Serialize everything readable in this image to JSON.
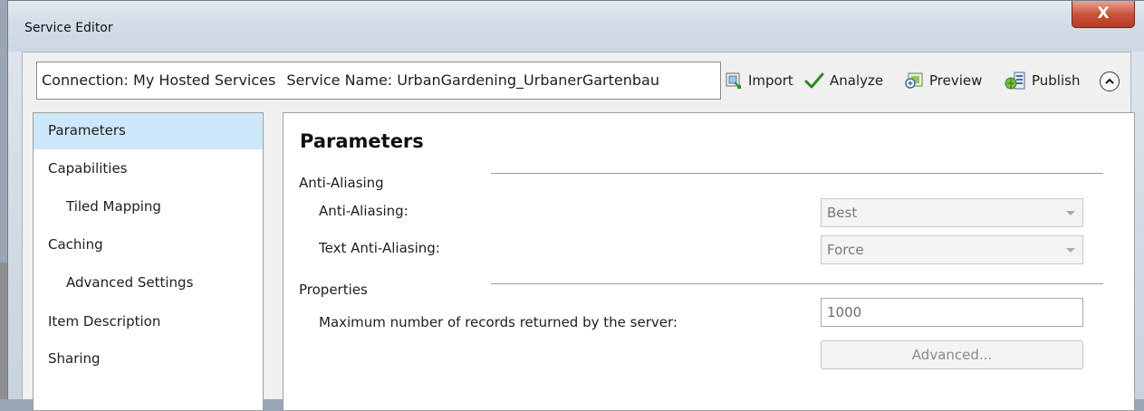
{
  "window": {
    "title": "Service Editor",
    "close_label": "X"
  },
  "info": {
    "connection": "Connection: My Hosted Services",
    "service_name": "Service Name: UrbanGardening_UrbanerGartenbau"
  },
  "toolbar": {
    "import_label": "Import",
    "analyze_label": "Analyze",
    "preview_label": "Preview",
    "publish_label": "Publish"
  },
  "sidebar": {
    "items": [
      {
        "label": "Parameters",
        "selected": true
      },
      {
        "label": "Capabilities"
      },
      {
        "label": "Tiled Mapping"
      },
      {
        "label": "Caching"
      },
      {
        "label": "Advanced Settings"
      },
      {
        "label": "Item Description"
      },
      {
        "label": "Sharing"
      }
    ]
  },
  "main": {
    "heading": "Parameters",
    "anti_aliasing": {
      "group_label": "Anti-Aliasing",
      "aa_label": "Anti-Aliasing:",
      "aa_value": "Best",
      "text_aa_label": "Text Anti-Aliasing:",
      "text_aa_value": "Force"
    },
    "properties": {
      "group_label": "Properties",
      "max_records_label": "Maximum number of records returned by the server:",
      "max_records_value": "1000",
      "advanced_label": "Advanced..."
    }
  },
  "colors": {
    "selected_item": "#cde8fb",
    "close_button": "#c9533c",
    "analyze_check": "#2e8b1e"
  }
}
